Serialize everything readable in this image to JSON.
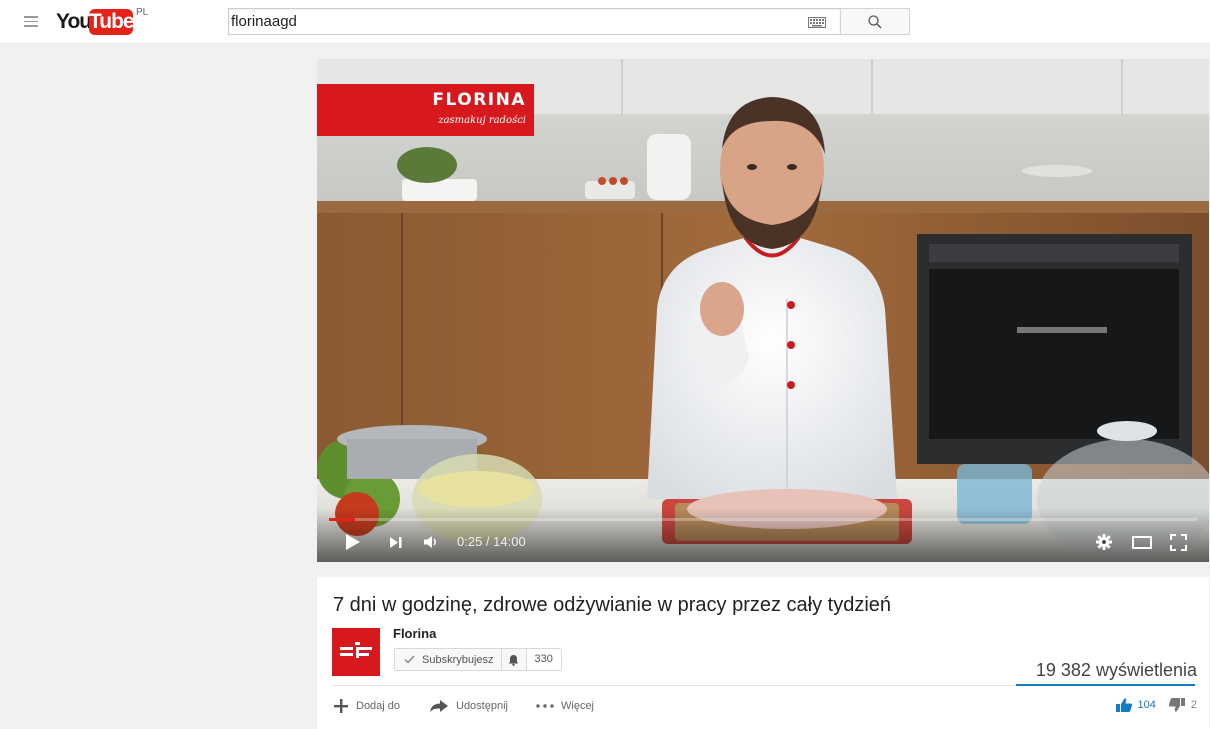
{
  "header": {
    "logo_you": "You",
    "logo_tube": "Tube",
    "logo_country": "PL",
    "search_value": "florinaagd"
  },
  "player": {
    "brand_name": "FLORINA",
    "brand_tagline": "zasmakuj radości",
    "current_time": "0:25",
    "duration": "14:00",
    "time_display": "0:25 / 14:00",
    "progress_fraction": 0.03
  },
  "video": {
    "title": "7 dni w godzinę, zdrowe odżywianie w pracy przez cały tydzień",
    "channel_name": "Florina",
    "subscribe_label": "Subskrybujesz",
    "subscriber_count": "330",
    "view_count": "19 382 wyświetlenia",
    "actions": {
      "add_to": "Dodaj do",
      "share": "Udostępnij",
      "more": "Więcej"
    },
    "likes": "104",
    "dislikes": "2",
    "like_fraction": 0.98
  },
  "colors": {
    "brand_red": "#d7191d",
    "youtube_red": "#e62117",
    "like_blue": "#167ac6"
  },
  "icons": [
    "menu-icon",
    "keyboard-icon",
    "search-icon",
    "play-icon",
    "next-icon",
    "volume-icon",
    "settings-icon",
    "theater-mode-icon",
    "fullscreen-icon",
    "check-icon",
    "bell-icon",
    "plus-icon",
    "share-icon",
    "more-icon",
    "thumbs-up-icon",
    "thumbs-down-icon"
  ]
}
